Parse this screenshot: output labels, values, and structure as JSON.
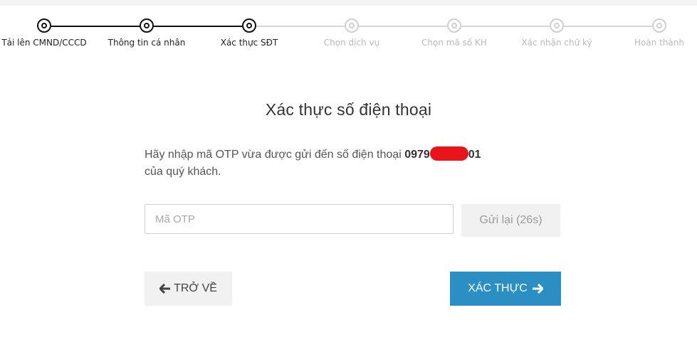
{
  "stepper": {
    "steps": [
      {
        "label": "Tải lên CMND/CCCD",
        "state": "completed"
      },
      {
        "label": "Thông tin cá nhân",
        "state": "completed"
      },
      {
        "label": "Xác thực SĐT",
        "state": "active"
      },
      {
        "label": "Chọn dịch vụ",
        "state": "pending"
      },
      {
        "label": "Chọn mã số KH",
        "state": "pending"
      },
      {
        "label": "Xác nhận chữ ký",
        "state": "pending"
      },
      {
        "label": "Hoàn thành",
        "state": "pending"
      }
    ]
  },
  "main": {
    "title": "Xác thực số điện thoại",
    "message_prefix": "Hãy nhập mã OTP vừa được gửi đến số điện thoại ",
    "phone_start": "0979",
    "phone_end": "01",
    "message_suffix": "của quý khách.",
    "otp": {
      "placeholder": "Mã OTP",
      "value": ""
    },
    "resend_label": "Gửi lại (26s)"
  },
  "actions": {
    "back_label": "TRỞ VỀ",
    "verify_label": "XÁC THỰC"
  },
  "colors": {
    "accent": "#2b8fc4",
    "active_step": "#111111",
    "inactive_step": "#cfcfcf",
    "redaction": "#e8141b"
  },
  "icons": {
    "back": "arrow-left-icon",
    "verify": "arrow-right-icon",
    "step_marker": "circle-dot-icon"
  }
}
